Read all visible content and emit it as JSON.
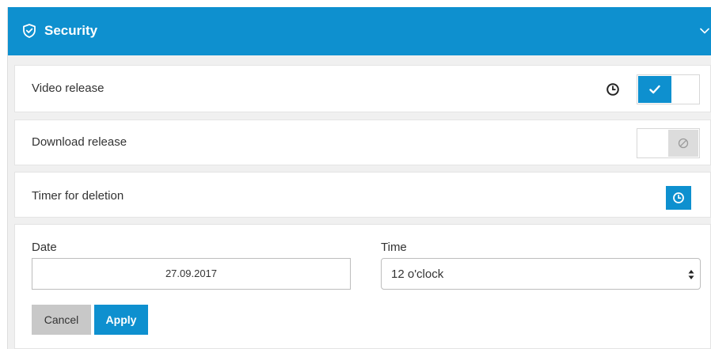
{
  "header": {
    "title": "Security",
    "icon": "shield-check-icon",
    "collapse_icon": "chevron-down-icon"
  },
  "colors": {
    "accent": "#0e90cf",
    "panel_bg": "#f0f0f0",
    "cancel_bg": "#c8c8c8"
  },
  "video_release": {
    "label": "Video release",
    "enabled": true,
    "icons": [
      "clock-icon",
      "checkmark-icon"
    ]
  },
  "download_release": {
    "label": "Download release",
    "enabled": false,
    "icons": [
      "disabled-icon"
    ]
  },
  "timer": {
    "label": "Timer for deletion",
    "icon": "clock-icon"
  },
  "form": {
    "date_label": "Date",
    "date_value": "27.09.2017",
    "time_label": "Time",
    "time_value": "12 o'clock",
    "cancel_label": "Cancel",
    "apply_label": "Apply"
  }
}
